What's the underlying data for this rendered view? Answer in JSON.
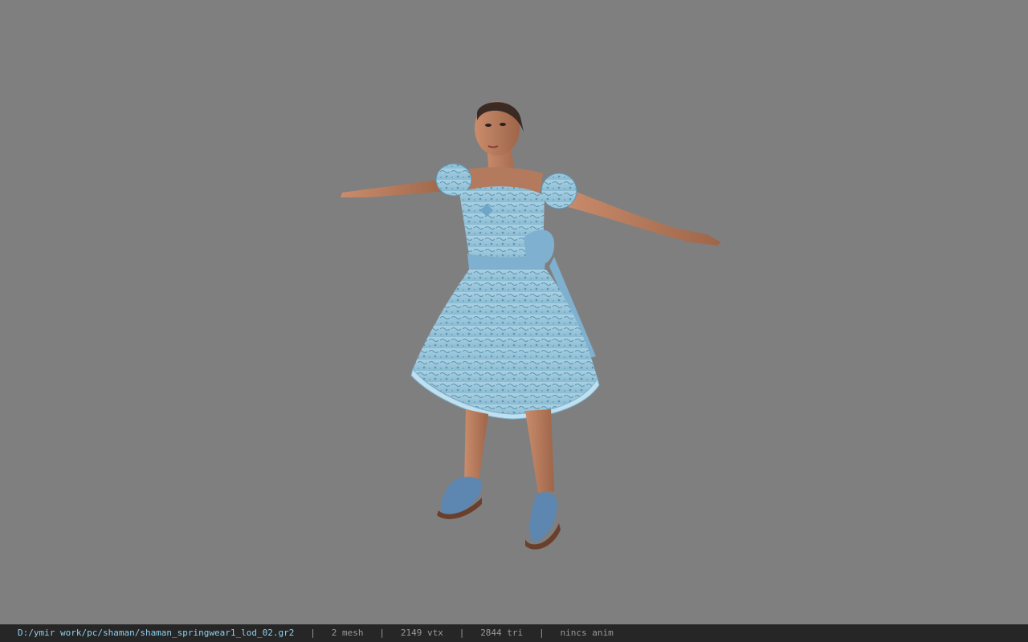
{
  "viewer": {
    "background_color": "#7f7f7f",
    "model_name": "shaman springwear model"
  },
  "statusbar": {
    "file_path": "D:/ymir work/pc/shaman/shaman_springwear1_lod_02.gr2",
    "sep1": "   |   ",
    "mesh": "2 mesh",
    "sep2": "   |   ",
    "vtx": "2149 vtx",
    "sep3": "   |   ",
    "tri": "2844 tri",
    "sep4": "   |   ",
    "anim": "nincs anim",
    "path_color": "#8fd0f0",
    "bg_color": "#262626"
  }
}
